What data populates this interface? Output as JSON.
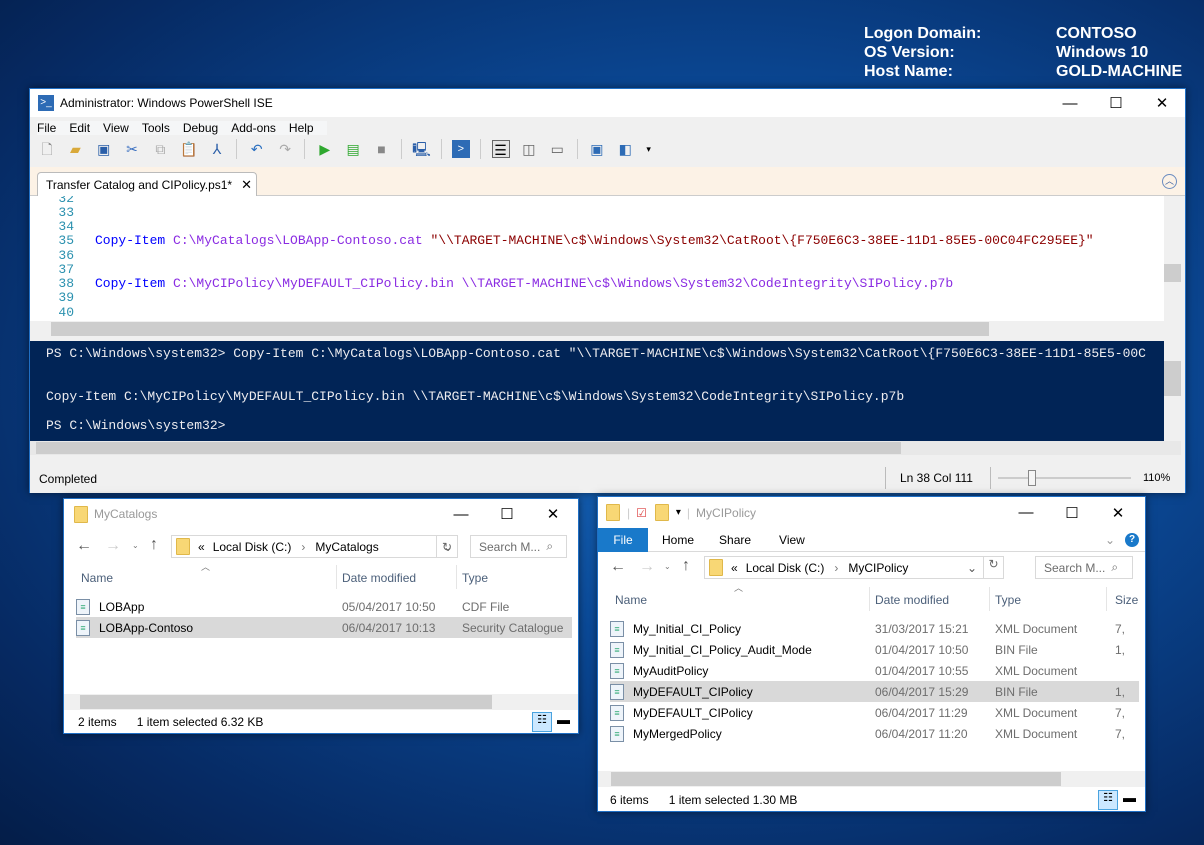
{
  "desktop_info": [
    {
      "label": "Logon Domain:",
      "value": "CONTOSO"
    },
    {
      "label": "OS Version:",
      "value": "Windows 10"
    },
    {
      "label": "Host Name:",
      "value": "GOLD-MACHINE"
    }
  ],
  "ise": {
    "title": "Administrator: Windows PowerShell ISE",
    "menu": [
      "File",
      "Edit",
      "View",
      "Tools",
      "Debug",
      "Add-ons",
      "Help"
    ],
    "toolbar_icons": [
      "new-icon",
      "open-icon",
      "save-icon",
      "cut-icon",
      "copy-icon",
      "paste-icon",
      "clear-icon",
      "undo-icon",
      "redo-icon",
      "run-icon",
      "run-selection-icon",
      "stop-icon",
      "remote-icon",
      "console-icon",
      "layout-top-icon",
      "layout-right-icon",
      "layout-max-icon",
      "show-command-icon",
      "show-addon-icon"
    ],
    "tab": {
      "label": "Transfer Catalog and CIPolicy.ps1*",
      "close": "✕"
    },
    "editor": {
      "line_numbers": [
        "32",
        "33",
        "34",
        "35",
        "36",
        "37",
        "38",
        "39",
        "40"
      ],
      "line35": {
        "cmd": "Copy-Item",
        "arg": "C:\\MyCatalogs\\LOBApp-Contoso.cat",
        "str": "\"\\\\TARGET-MACHINE\\c$\\Windows\\System32\\CatRoot\\{F750E6C3-38EE-11D1-85E5-00C04FC295EE}\""
      },
      "line38": {
        "cmd": "Copy-Item",
        "arg": "C:\\MyCIPolicy\\MyDEFAULT_CIPolicy.bin \\\\TARGET-MACHINE\\c$\\Windows\\System32\\CodeIntegrity\\SIPolicy.p7b"
      }
    },
    "console": {
      "line1": "PS C:\\Windows\\system32> Copy-Item C:\\MyCatalogs\\LOBApp-Contoso.cat \"\\\\TARGET-MACHINE\\c$\\Windows\\System32\\CatRoot\\{F750E6C3-38EE-11D1-85E5-00C",
      "line2": "Copy-Item C:\\MyCIPolicy\\MyDEFAULT_CIPolicy.bin \\\\TARGET-MACHINE\\c$\\Windows\\System32\\CodeIntegrity\\SIPolicy.p7b",
      "line3": "PS C:\\Windows\\system32>"
    },
    "status": {
      "text": "Completed",
      "position": "Ln 38  Col 111",
      "zoom": "110%",
      "zoom_value": 110
    }
  },
  "explorer1": {
    "title": "MyCatalogs",
    "breadcrumb": [
      "«",
      "Local Disk (C:)",
      "›",
      "MyCatalogs"
    ],
    "search_placeholder": "Search M...",
    "columns": [
      "Name",
      "Date modified",
      "Type"
    ],
    "rows": [
      {
        "name": "LOBApp",
        "date": "05/04/2017 10:50",
        "type": "CDF File"
      },
      {
        "name": "LOBApp-Contoso",
        "date": "06/04/2017 10:13",
        "type": "Security Catalogue",
        "selected": true
      }
    ],
    "status": {
      "count": "2 items",
      "selection": "1 item selected  6.32 KB"
    }
  },
  "explorer2": {
    "title": "MyCIPolicy",
    "ribbon": [
      "File",
      "Home",
      "Share",
      "View"
    ],
    "breadcrumb": [
      "«",
      "Local Disk (C:)",
      "›",
      "MyCIPolicy"
    ],
    "search_placeholder": "Search M...",
    "columns": [
      "Name",
      "Date modified",
      "Type",
      "Size"
    ],
    "rows": [
      {
        "name": "My_Initial_CI_Policy",
        "date": "31/03/2017 15:21",
        "type": "XML Document",
        "size": "7,"
      },
      {
        "name": "My_Initial_CI_Policy_Audit_Mode",
        "date": "01/04/2017 10:50",
        "type": "BIN File",
        "size": "1,"
      },
      {
        "name": "MyAuditPolicy",
        "date": "01/04/2017 10:55",
        "type": "XML Document",
        "size": ""
      },
      {
        "name": "MyDEFAULT_CIPolicy",
        "date": "06/04/2017 15:29",
        "type": "BIN File",
        "size": "1,",
        "selected": true
      },
      {
        "name": "MyDEFAULT_CIPolicy",
        "date": "06/04/2017 11:29",
        "type": "XML Document",
        "size": "7,"
      },
      {
        "name": "MyMergedPolicy",
        "date": "06/04/2017 11:20",
        "type": "XML Document",
        "size": "7,"
      }
    ],
    "status": {
      "count": "6 items",
      "selection": "1 item selected  1.30 MB"
    }
  },
  "colors": {
    "console_bg": "#012456",
    "ribbon_file": "#1979ca",
    "keyword": "#0000ff",
    "argument": "#8a2be2",
    "string": "#8b0000",
    "line_numbers": "#2b91af"
  }
}
